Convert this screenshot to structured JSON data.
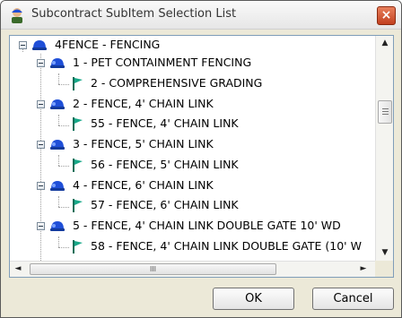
{
  "window": {
    "title": "Subcontract SubItem Selection List",
    "close_label": "×"
  },
  "tree": {
    "root": {
      "label": "4FENCE - FENCING",
      "icon": "hardhat-icon",
      "expanded": true
    },
    "groups": [
      {
        "label": "1 - PET CONTAINMENT FENCING",
        "icon": "hardhat-group-icon",
        "expanded": true,
        "child": {
          "label": "2 - COMPREHENSIVE GRADING",
          "icon": "flag-icon"
        }
      },
      {
        "label": "2 - FENCE, 4' CHAIN LINK",
        "icon": "hardhat-group-icon",
        "expanded": true,
        "child": {
          "label": "55 - FENCE, 4' CHAIN LINK",
          "icon": "flag-icon"
        }
      },
      {
        "label": "3 - FENCE, 5' CHAIN LINK",
        "icon": "hardhat-group-icon",
        "expanded": true,
        "child": {
          "label": "56 - FENCE, 5' CHAIN LINK",
          "icon": "flag-icon"
        }
      },
      {
        "label": "4 - FENCE, 6' CHAIN LINK",
        "icon": "hardhat-group-icon",
        "expanded": true,
        "child": {
          "label": "57 - FENCE, 6' CHAIN LINK",
          "icon": "flag-icon"
        }
      },
      {
        "label": "5 - FENCE, 4' CHAIN LINK DOUBLE GATE 10' WD",
        "icon": "hardhat-group-icon",
        "expanded": true,
        "child": {
          "label": "58 - FENCE, 4' CHAIN LINK DOUBLE GATE (10' W",
          "icon": "flag-icon"
        }
      }
    ]
  },
  "scrollbars": {
    "h_thumb_glyph": "III",
    "v_up": "▲",
    "v_down": "▼",
    "h_left": "◄",
    "h_right": "►"
  },
  "buttons": {
    "ok": "OK",
    "cancel": "Cancel"
  },
  "colors": {
    "hardhat": "#1f4fd8",
    "flag": "#17a888",
    "title_close": "#c24020"
  }
}
